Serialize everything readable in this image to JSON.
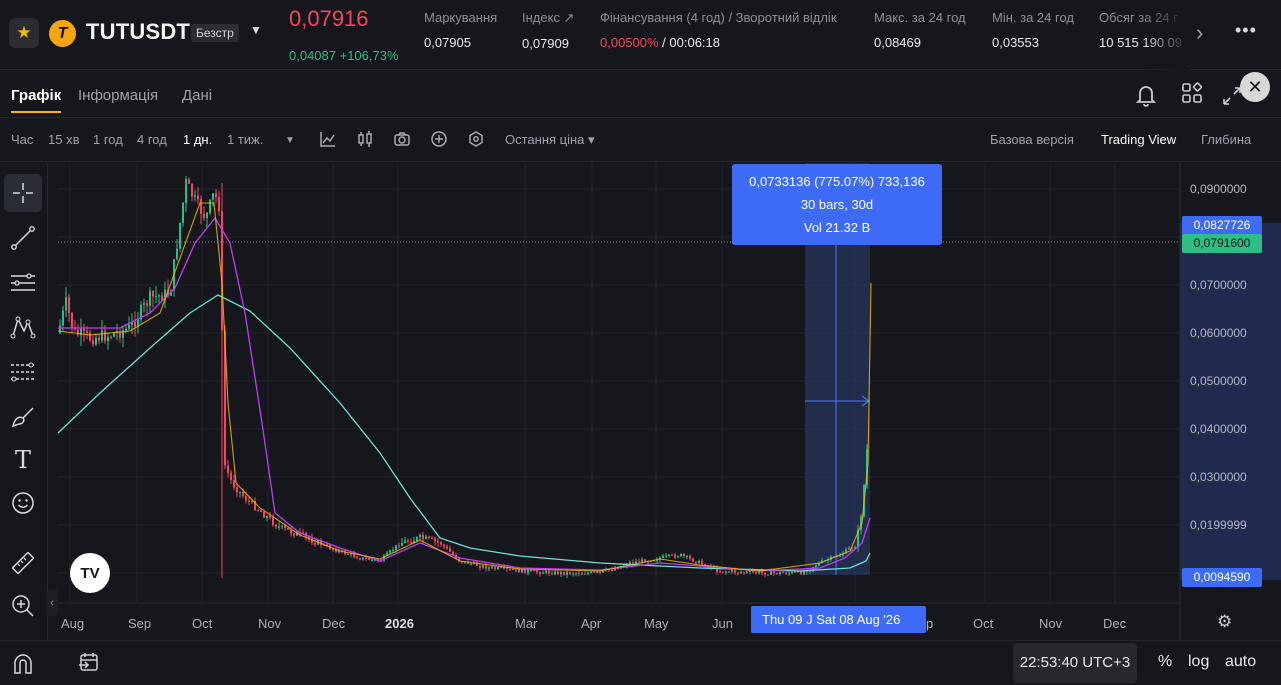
{
  "ticker": {
    "symbol": "TUTUSDT",
    "badge": "Безстр",
    "coin_letter": "T",
    "last_price": "0,07916",
    "change": "0,04087 +106,73%",
    "stats": [
      {
        "label": "Маркування",
        "value": "0,07905"
      },
      {
        "label": "Індекс ↗",
        "value": "0,07909"
      },
      {
        "label": "Фінансування (4 год) / Зворотний відлік",
        "value_neg": "0,00500%",
        "value": " /  00:06:18"
      },
      {
        "label": "Макс. за 24 год",
        "value": "0,08469"
      },
      {
        "label": "Мін. за 24 год",
        "value": "0,03553"
      },
      {
        "label": "Обсяг за 24 г",
        "value": "10 515 190 09"
      }
    ]
  },
  "tabs": [
    "Графік",
    "Інформація",
    "Дані"
  ],
  "toolbar": {
    "intervals": [
      "Час",
      "15 хв",
      "1 год",
      "4 год",
      "1 дн.",
      "1 тиж."
    ],
    "active_interval": "1 дн.",
    "price_type": "Остання ціна ▾",
    "views": [
      "Базова версія",
      "Trading View",
      "Глибина"
    ],
    "active_view": "Trading View"
  },
  "chart": {
    "price_axis": [
      "0,0900000",
      "0,0700000",
      "0,0600000",
      "0,0500000",
      "0,0400000",
      "0,0300000",
      "0,0199999"
    ],
    "price_tags": {
      "range_top": "0,0827726",
      "last": "0,0791600",
      "range_bottom": "0,0094590"
    },
    "time_axis": [
      "Aug",
      "Sep",
      "Oct",
      "Nov",
      "Dec",
      "2026",
      "Mar",
      "Apr",
      "May",
      "Jun",
      "p",
      "Oct",
      "Nov",
      "Dec"
    ],
    "time_tag": "Thu 09 J   Sat 08 Aug '26",
    "measure": {
      "line1": "0,0733136 (775.07%) 733,136",
      "line2": "30 bars, 30d",
      "line3": "Vol 21.32 B"
    },
    "colors": {
      "up": "#2ebd85",
      "down": "#f6465d",
      "ma_short": "#f0b90b",
      "ma_mid": "#c13df0",
      "ma_long": "#6fe0d4",
      "measure": "#3d6bf5"
    }
  },
  "bottom": {
    "clock": "22:53:40 UTC+3",
    "options": [
      "%",
      "log",
      "auto"
    ]
  }
}
